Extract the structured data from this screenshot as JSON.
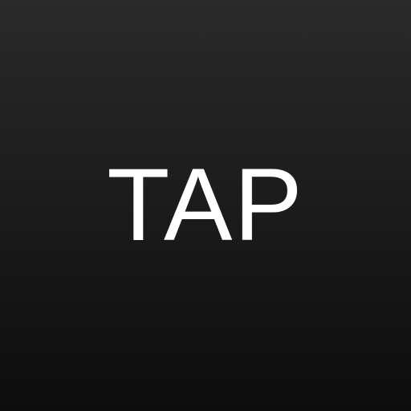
{
  "screen": {
    "label": "TAP",
    "colors": {
      "background_top": "#2a2a2a",
      "background_bottom": "#0d0d0d",
      "text": "#ffffff"
    }
  }
}
